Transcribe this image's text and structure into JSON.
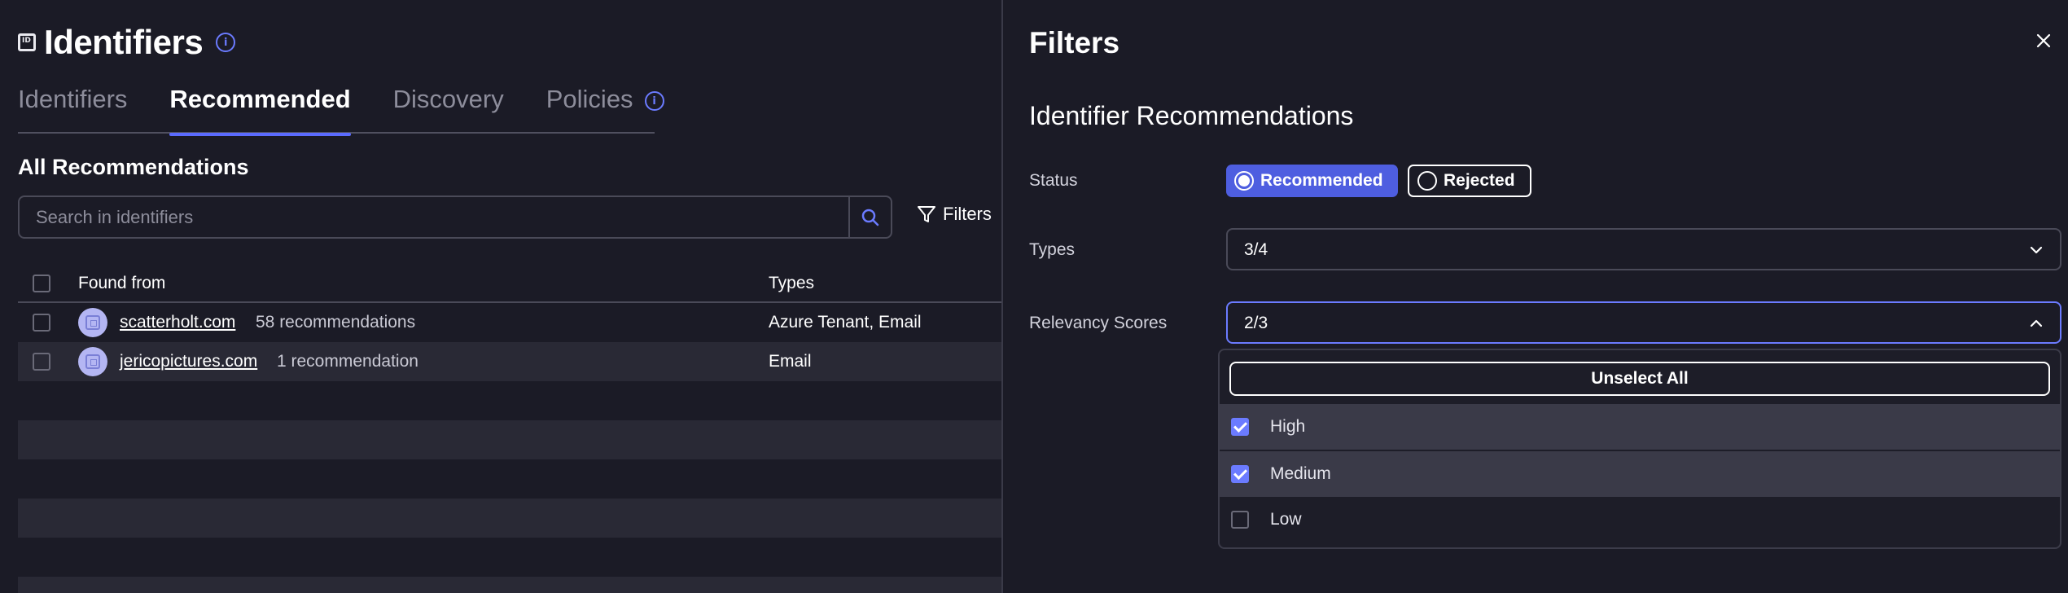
{
  "page": {
    "title": "Identifiers",
    "tabs": [
      {
        "label": "Identifiers"
      },
      {
        "label": "Recommended"
      },
      {
        "label": "Discovery"
      },
      {
        "label": "Policies"
      }
    ],
    "active_tab": "Recommended",
    "section_title": "All Recommendations",
    "search": {
      "placeholder": "Search in identifiers",
      "value": ""
    },
    "filters_label": "Filters"
  },
  "table": {
    "columns": [
      "Found from",
      "Types"
    ],
    "rows": [
      {
        "domain": "scatterholt.com",
        "recommendations": "58 recommendations",
        "types": "Azure Tenant, Email"
      },
      {
        "domain": "jericopictures.com",
        "recommendations": "1 recommendation",
        "types": "Email"
      }
    ]
  },
  "filter_panel": {
    "title": "Filters",
    "subtitle": "Identifier Recommendations",
    "status": {
      "label": "Status",
      "options": [
        {
          "label": "Recommended",
          "selected": true
        },
        {
          "label": "Rejected",
          "selected": false
        }
      ]
    },
    "types": {
      "label": "Types",
      "value": "3/4"
    },
    "relevancy": {
      "label": "Relevancy Scores",
      "value": "2/3",
      "unselect_all": "Unselect All",
      "options": [
        {
          "label": "High",
          "checked": true
        },
        {
          "label": "Medium",
          "checked": true
        },
        {
          "label": "Low",
          "checked": false
        }
      ]
    }
  },
  "colors": {
    "background": "#1b1b26",
    "accent": "#5b6bff",
    "pill_active": "#4e5ee0",
    "row_alt": "#292935"
  }
}
